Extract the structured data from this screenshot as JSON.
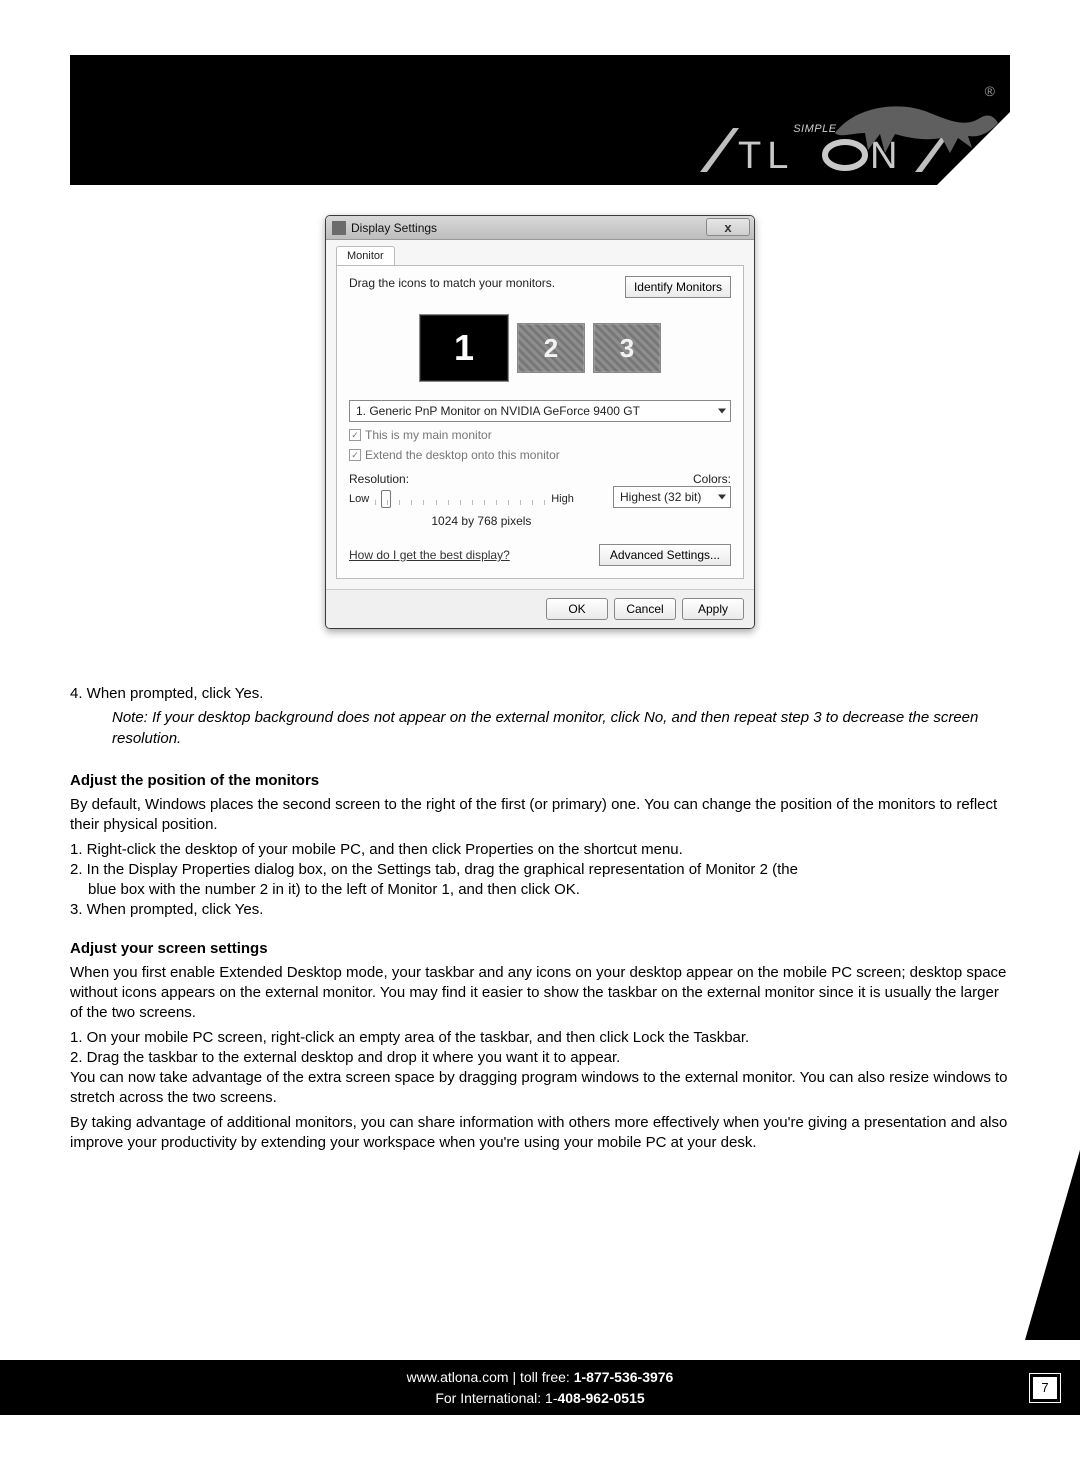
{
  "header": {
    "tagline": "SIMPLE, EASY",
    "brand": "ATLONA",
    "reg_mark": "®"
  },
  "dialog": {
    "title": "Display Settings",
    "tab": "Monitor",
    "instruction": "Drag the icons to match your monitors.",
    "identify_btn": "Identify Monitors",
    "monitor_labels": [
      "1",
      "2",
      "3"
    ],
    "monitor_dropdown": "1. Generic PnP Monitor on NVIDIA GeForce 9400 GT",
    "cb_main": "This is my main monitor",
    "cb_extend": "Extend the desktop onto this monitor",
    "resolution_label": "Resolution:",
    "colors_label": "Colors:",
    "low": "Low",
    "high": "High",
    "colors_value": "Highest (32 bit)",
    "resolution_value": "1024 by 768 pixels",
    "help_link": "How do I get the best display?",
    "advanced_btn": "Advanced Settings...",
    "ok": "OK",
    "cancel": "Cancel",
    "apply": "Apply",
    "close_x": "x"
  },
  "body": {
    "step4": "4. When prompted, click Yes.",
    "note": "Note:   If your desktop background does not appear on the external monitor, click No, and then repeat step 3 to decrease the screen resolution.",
    "secA_head": "Adjust the position of the monitors",
    "secA_p1": "By default, Windows places the second screen to the right of the first (or primary) one. You can change the position of the monitors to reflect their physical position.",
    "secA_s1": "1. Right-click the desktop of your mobile PC, and then click Properties on the shortcut menu.",
    "secA_s2a": "2. In the Display Properties dialog box, on the Settings tab, drag the graphical representation of Monitor 2 (the",
    "secA_s2b": "blue box with the number 2 in it) to the left of Monitor 1, and then click OK.",
    "secA_s3": "3. When prompted, click Yes.",
    "secB_head": "Adjust your screen settings",
    "secB_p1": "When you first enable Extended Desktop mode, your taskbar and any icons on your desktop appear on the mobile PC screen; desktop space without icons appears on the external monitor. You may find it easier to show the taskbar on the external monitor since it is usually the larger of the two screens.",
    "secB_s1": "1. On your mobile PC screen, right-click an empty area of the taskbar, and then click Lock the Taskbar.",
    "secB_s2": "2. Drag the taskbar to the external desktop and drop it where you want it to appear.",
    "secB_p2": "You can now take advantage of the extra screen space by dragging program windows to the external monitor. You can also resize windows to stretch across the two screens.",
    "secB_p3": "By taking advantage of additional monitors, you can share information with others more effectively when you're giving a presentation and also improve your productivity by extending your workspace when you're using your mobile PC at your desk."
  },
  "footer": {
    "line1a": "www.atlona.com | toll free: ",
    "line1b": "1-877-536-3976",
    "line2a": "For International: 1-",
    "line2b": "408-962-0515",
    "page": "7"
  }
}
